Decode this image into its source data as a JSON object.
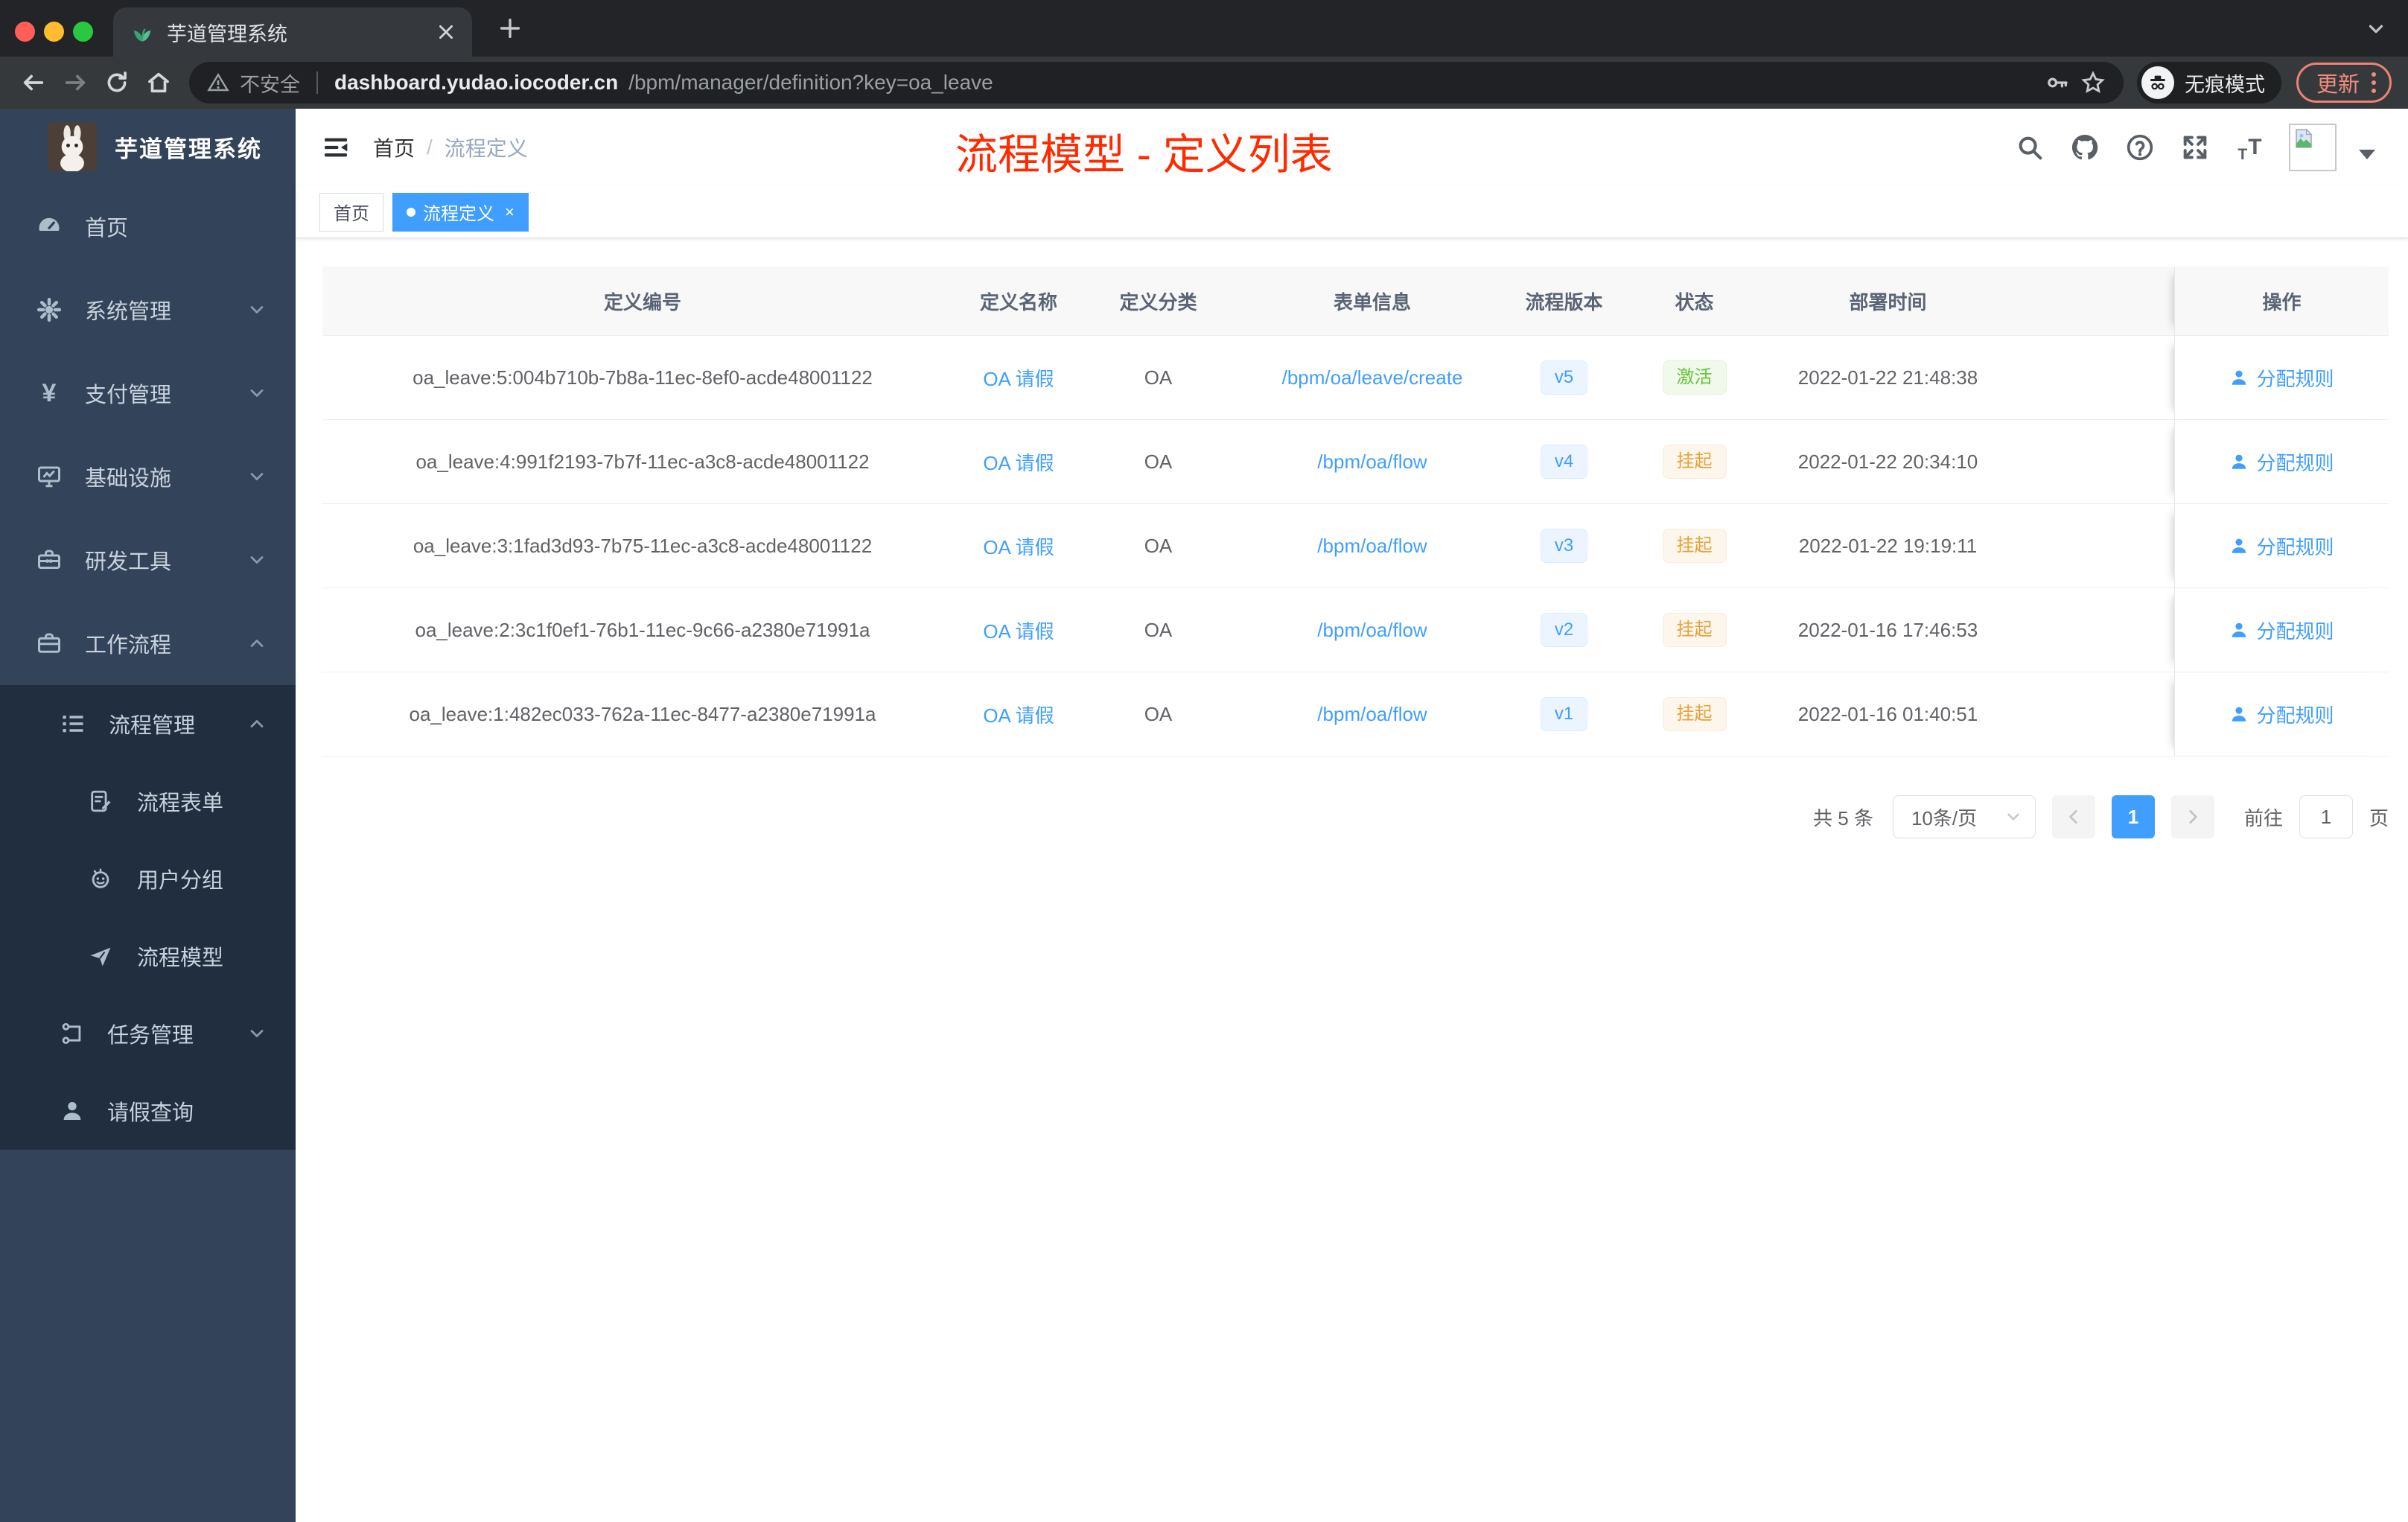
{
  "browser": {
    "tab_title": "芋道管理系统",
    "security_label": "不安全",
    "url_host": "dashboard.yudao.iocoder.cn",
    "url_path": "/bpm/manager/definition?key=oa_leave",
    "incognito_label": "无痕模式",
    "update_label": "更新"
  },
  "sidebar": {
    "title": "芋道管理系统",
    "items": [
      {
        "label": "首页"
      },
      {
        "label": "系统管理"
      },
      {
        "label": "支付管理"
      },
      {
        "label": "基础设施"
      },
      {
        "label": "研发工具"
      },
      {
        "label": "工作流程"
      },
      {
        "label": "流程管理"
      },
      {
        "label": "流程表单"
      },
      {
        "label": "用户分组"
      },
      {
        "label": "流程模型"
      },
      {
        "label": "任务管理"
      },
      {
        "label": "请假查询"
      }
    ]
  },
  "header": {
    "breadcrumb_home": "首页",
    "breadcrumb_separator": "/",
    "breadcrumb_current": "流程定义",
    "annotation": "流程模型 - 定义列表"
  },
  "tags": [
    {
      "label": "首页"
    },
    {
      "label": "流程定义"
    }
  ],
  "table": {
    "columns": [
      "定义编号",
      "定义名称",
      "定义分类",
      "表单信息",
      "流程版本",
      "状态",
      "部署时间",
      "操作"
    ],
    "action_label": "分配规则",
    "rows": [
      {
        "id": "oa_leave:5:004b710b-7b8a-11ec-8ef0-acde48001122",
        "name": "OA 请假",
        "category": "OA",
        "form": "/bpm/oa/leave/create",
        "version": "v5",
        "status": "激活",
        "deployed_at": "2022-01-22 21:48:38"
      },
      {
        "id": "oa_leave:4:991f2193-7b7f-11ec-a3c8-acde48001122",
        "name": "OA 请假",
        "category": "OA",
        "form": "/bpm/oa/flow",
        "version": "v4",
        "status": "挂起",
        "deployed_at": "2022-01-22 20:34:10"
      },
      {
        "id": "oa_leave:3:1fad3d93-7b75-11ec-a3c8-acde48001122",
        "name": "OA 请假",
        "category": "OA",
        "form": "/bpm/oa/flow",
        "version": "v3",
        "status": "挂起",
        "deployed_at": "2022-01-22 19:19:11"
      },
      {
        "id": "oa_leave:2:3c1f0ef1-76b1-11ec-9c66-a2380e71991a",
        "name": "OA 请假",
        "category": "OA",
        "form": "/bpm/oa/flow",
        "version": "v2",
        "status": "挂起",
        "deployed_at": "2022-01-16 17:46:53"
      },
      {
        "id": "oa_leave:1:482ec033-762a-11ec-8477-a2380e71991a",
        "name": "OA 请假",
        "category": "OA",
        "form": "/bpm/oa/flow",
        "version": "v1",
        "status": "挂起",
        "deployed_at": "2022-01-16 01:40:51"
      }
    ]
  },
  "pagination": {
    "total": "共 5 条",
    "page_size": "10条/页",
    "current_page": "1",
    "goto_label": "前往",
    "goto_value": "1",
    "unit_label": "页"
  },
  "colors": {
    "accent": "#409eff",
    "status_active": "#67c23a",
    "status_suspended": "#e6a23c",
    "annotation": "#fe2b01",
    "sidebar_bg": "#334359",
    "submenu_bg": "#202e40"
  }
}
